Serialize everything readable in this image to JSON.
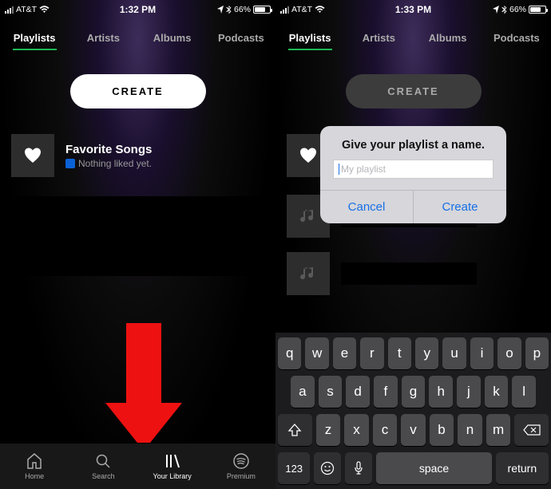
{
  "left": {
    "status": {
      "carrier": "AT&T",
      "time": "1:32 PM",
      "battery": "66%",
      "bt": "✱"
    },
    "tabs": [
      "Playlists",
      "Artists",
      "Albums",
      "Podcasts"
    ],
    "create": "CREATE",
    "fav": {
      "title": "Favorite Songs",
      "sub": "Nothing liked yet."
    },
    "nav": [
      "Home",
      "Search",
      "Your Library",
      "Premium"
    ]
  },
  "right": {
    "status": {
      "carrier": "AT&T",
      "time": "1:33 PM",
      "battery": "66%"
    },
    "tabs": [
      "Playlists",
      "Artists",
      "Albums",
      "Podcasts"
    ],
    "create": "CREATE",
    "modal": {
      "title": "Give your playlist a name.",
      "placeholder": "My playlist",
      "cancel": "Cancel",
      "ok": "Create"
    },
    "kb": {
      "row1": [
        "q",
        "w",
        "e",
        "r",
        "t",
        "y",
        "u",
        "i",
        "o",
        "p"
      ],
      "row2": [
        "a",
        "s",
        "d",
        "f",
        "g",
        "h",
        "j",
        "k",
        "l"
      ],
      "row3": [
        "z",
        "x",
        "c",
        "v",
        "b",
        "n",
        "m"
      ],
      "n123": "123",
      "space": "space",
      "ret": "return"
    }
  }
}
